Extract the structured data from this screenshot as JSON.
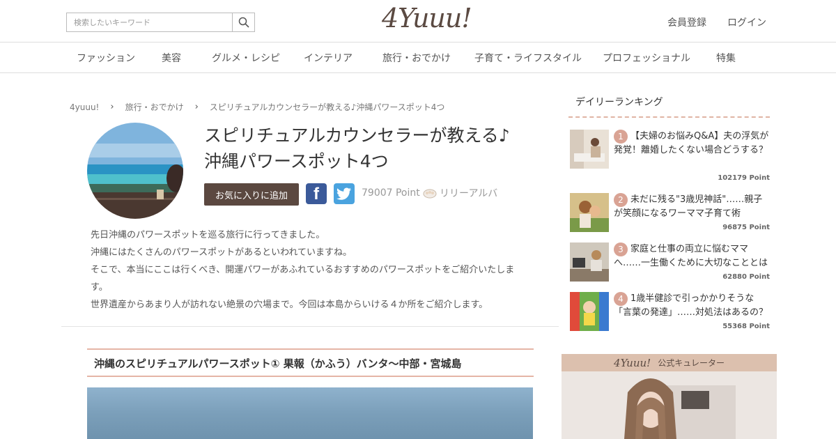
{
  "header": {
    "search_placeholder": "検索したいキーワード",
    "logo": "4Yuuu!",
    "links": [
      "会員登録",
      "ログイン"
    ]
  },
  "categories": [
    "ファッション",
    "美容",
    "グルメ・レシピ",
    "インテリア",
    "旅行・おでかけ",
    "子育て・ライフスタイル",
    "プロフェッショナル",
    "特集"
  ],
  "breadcrumb": [
    "4yuuu!",
    "旅行・おでかけ",
    "スピリチュアルカウンセラーが教える♪沖縄パワースポット4つ"
  ],
  "article": {
    "title_line1": "スピリチュアルカウンセラーが教える♪",
    "title_line2": "沖縄パワースポット4つ",
    "fav_button": "お気に入りに追加",
    "points": "79007 Point",
    "author": "リリーアルバ",
    "intro": [
      "先日沖縄のパワースポットを巡る旅行に行ってきました。",
      "沖縄にはたくさんのパワースポットがあるといわれていますね。",
      "そこで、本当にここは行くべき、開運パワーがあふれているおすすめのパワースポットをご紹介いたしま",
      "す。",
      "世界遺産からあまり人が訪れない絶景の穴場まで。今回は本島からいける４か所をご紹介します。"
    ],
    "section_title": "沖縄のスピリチュアルパワースポット① 果報（かふう）バンタ～中部・宮城島"
  },
  "ranking": {
    "heading": "デイリーランキング",
    "items": [
      {
        "num": "1",
        "text": "【夫婦のお悩みQ&A】夫の浮気が発覚！離婚したくない場合どうする？",
        "points": "102179 Point"
      },
      {
        "num": "2",
        "text": "未だに残る\"3歳児神話\"……親子が笑顔になるワーママ子育て術",
        "points": "96875 Point"
      },
      {
        "num": "3",
        "text": "家庭と仕事の両立に悩むママへ……一生働くために大切なこととは",
        "points": "62880 Point"
      },
      {
        "num": "4",
        "text": "1歳半健診で引っかかりそうな「言葉の発達」……対処法はあるの？",
        "points": "55368 Point"
      }
    ]
  },
  "curator": {
    "logo": "4Yuuu!",
    "label": "公式キュレーター"
  },
  "colors": {
    "brand_brown": "#5b4840",
    "accent_pink": "#d9a394",
    "facebook": "#3b5a9a",
    "twitter": "#4aa3df"
  }
}
